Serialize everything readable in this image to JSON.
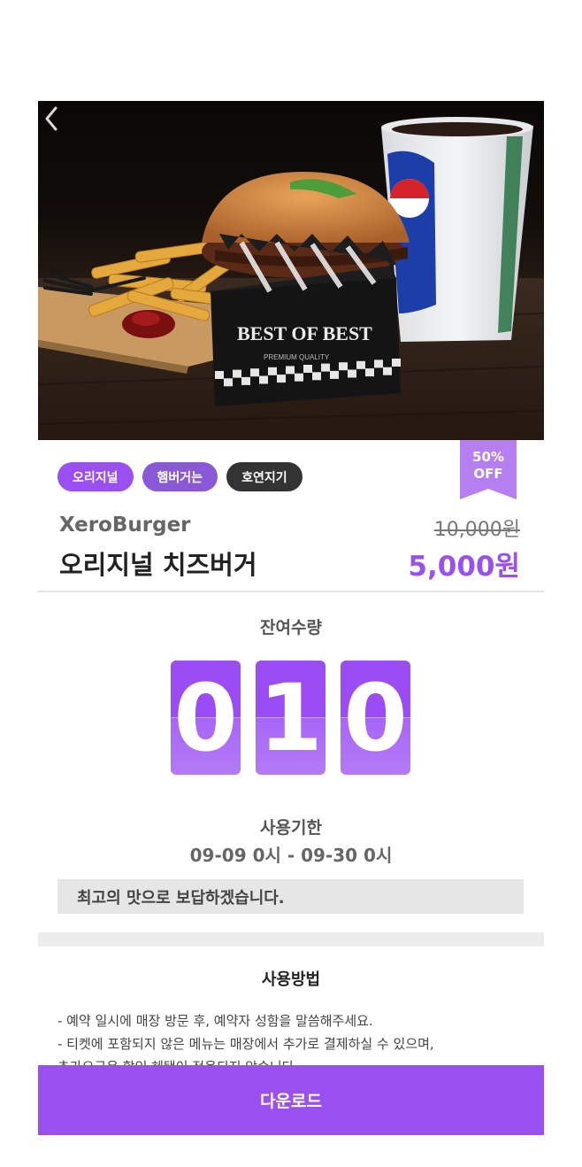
{
  "hero": {
    "box_text": "BEST OF BEST",
    "box_subtext": "PREMIUM QUALITY"
  },
  "tags": [
    "오리지널",
    "햄버거는",
    "호연지기"
  ],
  "discount": {
    "line1": "50%",
    "line2": "OFF"
  },
  "product": {
    "brand": "XeroBurger",
    "name": "오리지널 치즈버거",
    "original_price": "10,000원",
    "sale_price": "5,000원"
  },
  "remaining": {
    "label": "잔여수량",
    "digits": [
      "0",
      "1",
      "0"
    ]
  },
  "expiry": {
    "label": "사용기한",
    "value": "09-09 0시 - 09-30 0시"
  },
  "message": "최고의 맛으로 보답하겠습니다.",
  "howto": {
    "title": "사용방법",
    "lines": [
      "- 예약 일시에 매장 방문 후, 예약자 성함을 말씀해주세요.",
      "- 티켓에 포함되지 않은 메뉴는 매장에서 추가로 결제하실 수 있으며,",
      "추가요금은 할인 혜택이 적용되지 않습니다."
    ]
  },
  "download_label": "다운로드",
  "colors": {
    "accent": "#9a4ff0",
    "dark_tag": "#333333"
  },
  "icons": {
    "back": "chevron-left-icon"
  }
}
